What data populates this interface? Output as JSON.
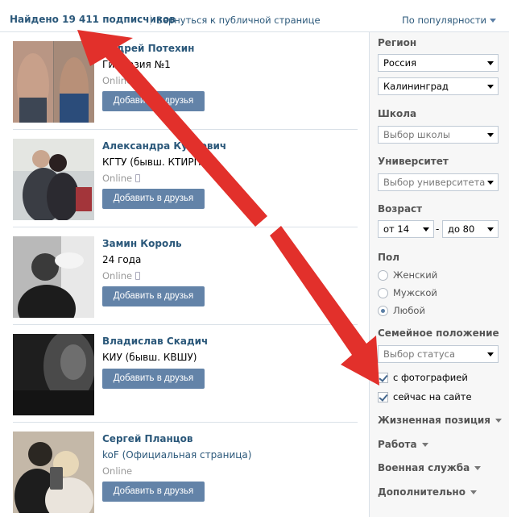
{
  "header": {
    "found_text": "Найдено 19 411 подписчиков",
    "separator": "|",
    "back_link": "Вернуться к публичной странице",
    "sort_label": "По популярности"
  },
  "results": [
    {
      "name": "Андрей Потехин",
      "line2": "Гимназия №1",
      "status": "Online",
      "button": "Добавить в друзья"
    },
    {
      "name": "Александра Курсевич",
      "line2": "КГТУ (бывш. КТИРПиХ)",
      "status": "Online",
      "button": "Добавить в друзья"
    },
    {
      "name": "Замин Король",
      "line2": "24 года",
      "status": "Online",
      "button": "Добавить в друзья"
    },
    {
      "name": "Владислав Скадич",
      "line2": "КИУ (бывш. КВШУ)",
      "status": "",
      "button": "Добавить в друзья"
    },
    {
      "name": "Сергей Планцов",
      "line2": "koF (Официальная страница)",
      "status": "Online",
      "button": "Добавить в друзья"
    }
  ],
  "filters": {
    "region_label": "Регион",
    "country": "Россия",
    "city": "Калининград",
    "school_label": "Школа",
    "school_placeholder": "Выбор школы",
    "university_label": "Университет",
    "university_placeholder": "Выбор университета",
    "age_label": "Возраст",
    "age_from": "от 14",
    "age_dash": "-",
    "age_to": "до 80",
    "sex_label": "Пол",
    "sex_options": [
      "Женский",
      "Мужской",
      "Любой"
    ],
    "sex_selected": "Любой",
    "marital_label": "Семейное положение",
    "marital_placeholder": "Выбор статуса",
    "with_photo": "с фотографией",
    "online_now": "сейчас на сайте",
    "sections": [
      "Жизненная позиция",
      "Работа",
      "Военная служба",
      "Дополнительно"
    ]
  },
  "colors": {
    "link": "#2b587a",
    "button": "#6383a8",
    "arrow": "#e2302b"
  }
}
